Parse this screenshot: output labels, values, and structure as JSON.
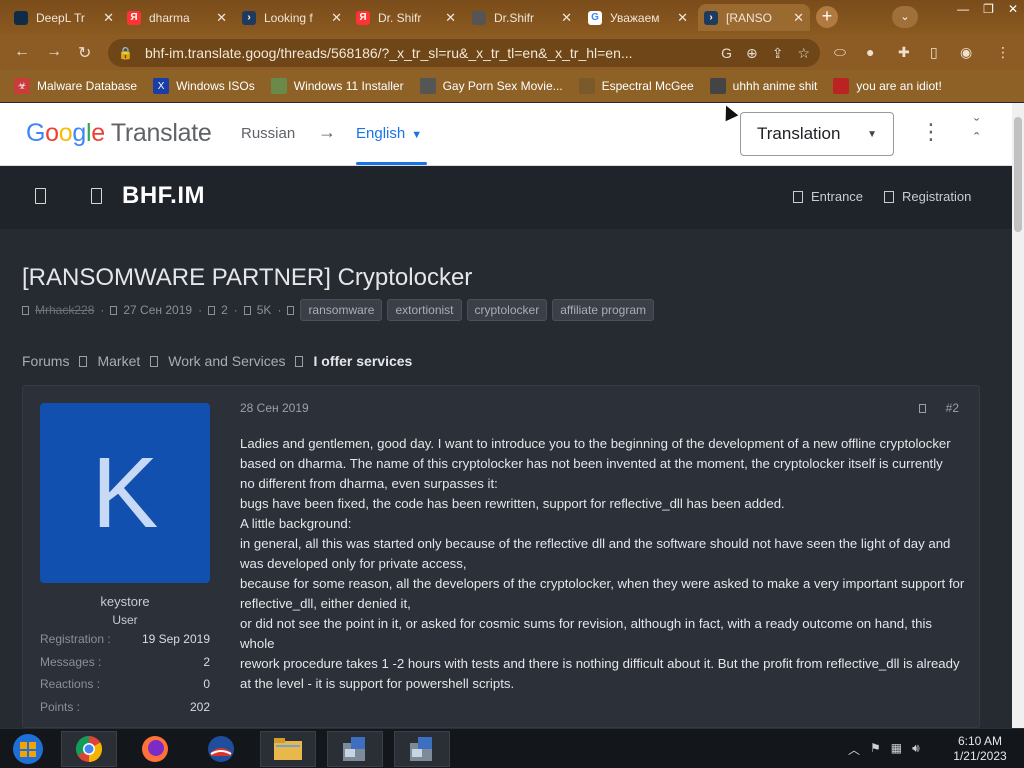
{
  "browser": {
    "tabs": [
      {
        "title": "DeepL Tr",
        "icon": "deepl-icon",
        "color": "#0f2b46"
      },
      {
        "title": "dharma",
        "icon": "yandex-icon",
        "color": "#ff3333"
      },
      {
        "title": "Looking f",
        "icon": "terminal-icon",
        "color": "#1e3a5f"
      },
      {
        "title": "Dr. Shifr",
        "icon": "yandex-icon",
        "color": "#ff3333"
      },
      {
        "title": "Dr.Shifr",
        "icon": "globe-icon",
        "color": "#555555"
      },
      {
        "title": "Уважаем",
        "icon": "google-icon",
        "color": "#ffffff"
      },
      {
        "title": "[RANSO",
        "icon": "terminal-icon",
        "color": "#1e3a5f"
      }
    ],
    "url": "bhf-im.translate.goog/threads/568186/?_x_tr_sl=ru&_x_tr_tl=en&_x_tr_hl=en...",
    "bookmarks": [
      {
        "label": "Malware Database",
        "icon": "biohazard-icon"
      },
      {
        "label": "Windows ISOs",
        "icon": "x-icon"
      },
      {
        "label": "Windows 11 Installer",
        "icon": "image-icon"
      },
      {
        "label": "Gay Porn Sex Movie...",
        "icon": "face-icon"
      },
      {
        "label": "Espectral McGee",
        "icon": "face-icon"
      },
      {
        "label": "uhhh anime shit",
        "icon": "face-icon"
      },
      {
        "label": "you are an idiot!",
        "icon": "flag-icon"
      }
    ]
  },
  "translate_bar": {
    "logo_google": "Google",
    "logo_translate": "Translate",
    "source_lang": "Russian",
    "arrow": "→",
    "target_lang": "English",
    "mode": "Translation"
  },
  "site": {
    "name": "BHF.IM",
    "login": "Entrance",
    "register": "Registration"
  },
  "thread": {
    "title": "[RANSOMWARE PARTNER] Cryptolocker",
    "author": "Mrhack228",
    "date": "27 Сен 2019",
    "replies": "2",
    "views": "5K",
    "tags": [
      "ransomware",
      "extortionist",
      "cryptolocker",
      "affiliate program"
    ]
  },
  "breadcrumbs": [
    "Forums",
    "Market",
    "Work and Services",
    "I offer services"
  ],
  "post": {
    "date": "28 Сен 2019",
    "number": "#2",
    "avatar_letter": "K",
    "username": "keystore",
    "role": "User",
    "stats": [
      {
        "label": "Registration :",
        "value": "19 Sep 2019"
      },
      {
        "label": "Messages :",
        "value": "2"
      },
      {
        "label": "Reactions :",
        "value": "0"
      },
      {
        "label": "Points :",
        "value": "202"
      }
    ],
    "lines": [
      "Ladies and gentlemen, good day. I want to introduce you to the beginning of the development of a new offline cryptolocker",
      "based on dharma. The name of this cryptolocker has not been invented at the moment, the cryptolocker itself is currently",
      "no different from dharma, even surpasses it:",
      "bugs have been fixed, the code has been rewritten, support for reflective_dll has been added.",
      "A little background:",
      "in general, all this was started only because of the reflective dll and the software should not have seen the light of day and was developed only for private access,",
      "because for some reason, all the developers of the cryptolocker, when they were asked to make a very important support for reflective_dll, either denied it,",
      "or did not see the point in it, or asked for cosmic sums for revision, although in fact, with a ready outcome on hand, this whole",
      "rework procedure takes 1 -2 hours with tests and there is nothing difficult about it. But the profit from reflective_dll is already at the level - it is support for powershell scripts."
    ]
  },
  "taskbar": {
    "time": "6:10 AM",
    "date": "1/21/2023"
  }
}
